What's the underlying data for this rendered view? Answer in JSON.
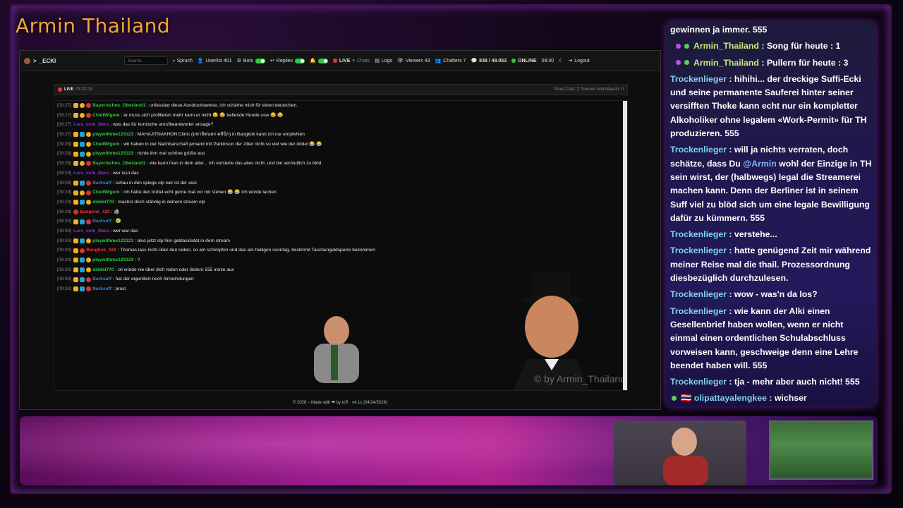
{
  "stream": {
    "channel_title": "Armin Thailand",
    "watermark": "© by Armin_Thailand"
  },
  "navbar": {
    "brand": "_ECKI",
    "search_placeholder": "Search...",
    "spruch": "Spruch",
    "userlist": "Userlist 401",
    "bots": "Bots",
    "replies": "Replies",
    "live": "LIVE",
    "chats": "Chats",
    "logs": "Logs",
    "viewers": "Viewers  43",
    "chatters": "Chatters  7",
    "msgs": "838 / 48.053",
    "online": "ONLINE",
    "time": "09:30",
    "logout": "Logout"
  },
  "chat_header": {
    "live": "LIVE",
    "duration": "03:32:23",
    "right": "Prost Chat: 2   Timeout schnittlauch: 0"
  },
  "messages": [
    {
      "ts": "[09:27]",
      "user": "Bayerisches_Oberland1",
      "color": "#2ecc40",
      "text": "unfassbar diese Ausdrucksweise. ich schäme mich für einen deutschen.",
      "badges": "mcr"
    },
    {
      "ts": "[09:27]",
      "user": "ChiefWigum",
      "color": "#2ecc40",
      "text": "er muss sich profilieren mehr kann er nicht 😂 😂 bellende Hunde usw 😂 😂",
      "badges": "mcr"
    },
    {
      "ts": "[09:27]",
      "user": "Lars_vom_Mars",
      "color": "#8a2be2",
      "text": "was das für komische anrufbeantworter ansage?",
      "badges": ""
    },
    {
      "ts": "[09:27]",
      "user": "playwithme123123",
      "color": "#2ecc40",
      "text": "MAHAJITNAKHON Clinic (มหาจิตนคร คลินิก) in Bangkok kann ich nur empfehlen",
      "badges": "mbc"
    },
    {
      "ts": "[09:28]",
      "user": "ChiefWigum",
      "color": "#2ecc40",
      "text": "wir haben in der Nachbarschaft jemand mit Parkinson der zitter nicht so viel wie der dödel 😂 😂",
      "badges": "mbc"
    },
    {
      "ts": "[09:28]",
      "user": "playwithme123123",
      "color": "#2ecc40",
      "text": "richte ihm mal schöne grüße aus",
      "badges": "mbc"
    },
    {
      "ts": "[09:28]",
      "user": "Bayerisches_Oberland1",
      "color": "#2ecc40",
      "text": "wie kann man in dem alter... ich verstehe das alles nicht. und bin vermutlich zu blöd.",
      "badges": "mcr"
    },
    {
      "ts": "[09:29]",
      "user": "Lars_vom_Mars",
      "color": "#8a2be2",
      "text": "wer issn das",
      "badges": ""
    },
    {
      "ts": "[09:29]",
      "user": "Darksuff",
      "color": "#1e90ff",
      "text": "schau in den spiege olp wer ist der assi",
      "badges": "mbr"
    },
    {
      "ts": "[09:29]",
      "user": "ChiefWigum",
      "color": "#2ecc40",
      "text": "ich hätte den trottel echt gerne mal vor mir stehen 😂 😂 ich würde lachen",
      "badges": "mcr"
    },
    {
      "ts": "[09:29]",
      "user": "diddel770",
      "color": "#2ecc40",
      "text": "machst doch ständig in deinem stream olp",
      "badges": "mbc"
    },
    {
      "ts": "[09:29]",
      "user": "Bangkok_420",
      "color": "#e33",
      "text": "🪨",
      "badges": "r"
    },
    {
      "ts": "[09:30]",
      "user": "Darksuff",
      "color": "#1e90ff",
      "text": "🤢",
      "badges": "mbr"
    },
    {
      "ts": "[09:30]",
      "user": "Lars_vom_Mars",
      "color": "#8a2be2",
      "text": "wer war das",
      "badges": ""
    },
    {
      "ts": "[09:30]",
      "user": "playwithme123123",
      "color": "#2ecc40",
      "text": "also jetzt olp hier geblacklistet in dem stream",
      "badges": "mbc"
    },
    {
      "ts": "[09:30]",
      "user": "Bangkok_420",
      "color": "#e33",
      "text": "Thomas lass nicht über den reden, so am schimpfen und das am heiligen sonntag, bestimmt Taschengeldsperre bekommen",
      "badges": "mr"
    },
    {
      "ts": "[09:30]",
      "user": "playwithme123123",
      "color": "#2ecc40",
      "text": "?",
      "badges": "mbc"
    },
    {
      "ts": "[09:30]",
      "user": "diddel770",
      "color": "#2ecc40",
      "text": "oli würde nie über dich reden oder lästern 555 ironie aus",
      "badges": "mbc"
    },
    {
      "ts": "[09:30]",
      "user": "Darksuff",
      "color": "#1e90ff",
      "text": "hat der eigentlich noch hirnwindungen",
      "badges": "mbr"
    },
    {
      "ts": "[09:30]",
      "user": "Darksuff",
      "color": "#1e90ff",
      "text": "prost",
      "badges": "mbr"
    }
  ],
  "footer": "© 2026 – Made with ❤ by tcR · v4.1c (04/24/2026)",
  "overlay_chat": [
    {
      "type": "plain",
      "text": "gewinnen ja immer. 555"
    },
    {
      "type": "armin",
      "user": "Armin_Thailand",
      "text": ": Song für heute : 1"
    },
    {
      "type": "armin",
      "user": "Armin_Thailand",
      "text": ": Pullern für heute : 3"
    },
    {
      "type": "user",
      "user": "Trockenlieger",
      "text": ": hihihi... der dreckige Suffi-Ecki und seine permanente Sauferei hinter seiner versifften Theke kann echt nur ein kompletter Alkoholiker ohne legalem «Work-Permit» für TH produzieren. 555"
    },
    {
      "type": "user",
      "user": "Trockenlieger",
      "text": ": will ja nichts verraten, doch schätze, dass Du @Armin wohl der Einzige in TH sein wirst, der (halbwegs) legal die Streamerei machen kann. Denn der Berliner ist in seinem Suff viel zu blöd sich um eine legale Bewilligung dafür zu kümmern. 555"
    },
    {
      "type": "user",
      "user": "Trockenlieger",
      "text": ": verstehe..."
    },
    {
      "type": "user",
      "user": "Trockenlieger",
      "text": ": hatte genügend Zeit mir während meiner Reise mal die thail. Prozessordnung diesbezüglich durchzulesen."
    },
    {
      "type": "user",
      "user": "Trockenlieger",
      "text": ": wow - was'n da los?"
    },
    {
      "type": "user",
      "user": "Trockenlieger",
      "text": ": wie kann der Alki einen Gesellenbrief haben wollen, wenn er nicht einmal einen ordentlichen Schulabschluss vorweisen kann, geschweige denn eine Lehre beendet haben will. 555"
    },
    {
      "type": "user",
      "user": "Trockenlieger",
      "text": ": tja - mehr aber auch nicht! 555"
    },
    {
      "type": "flag",
      "user": "olipattayalengkee",
      "text": ": wichser"
    }
  ]
}
